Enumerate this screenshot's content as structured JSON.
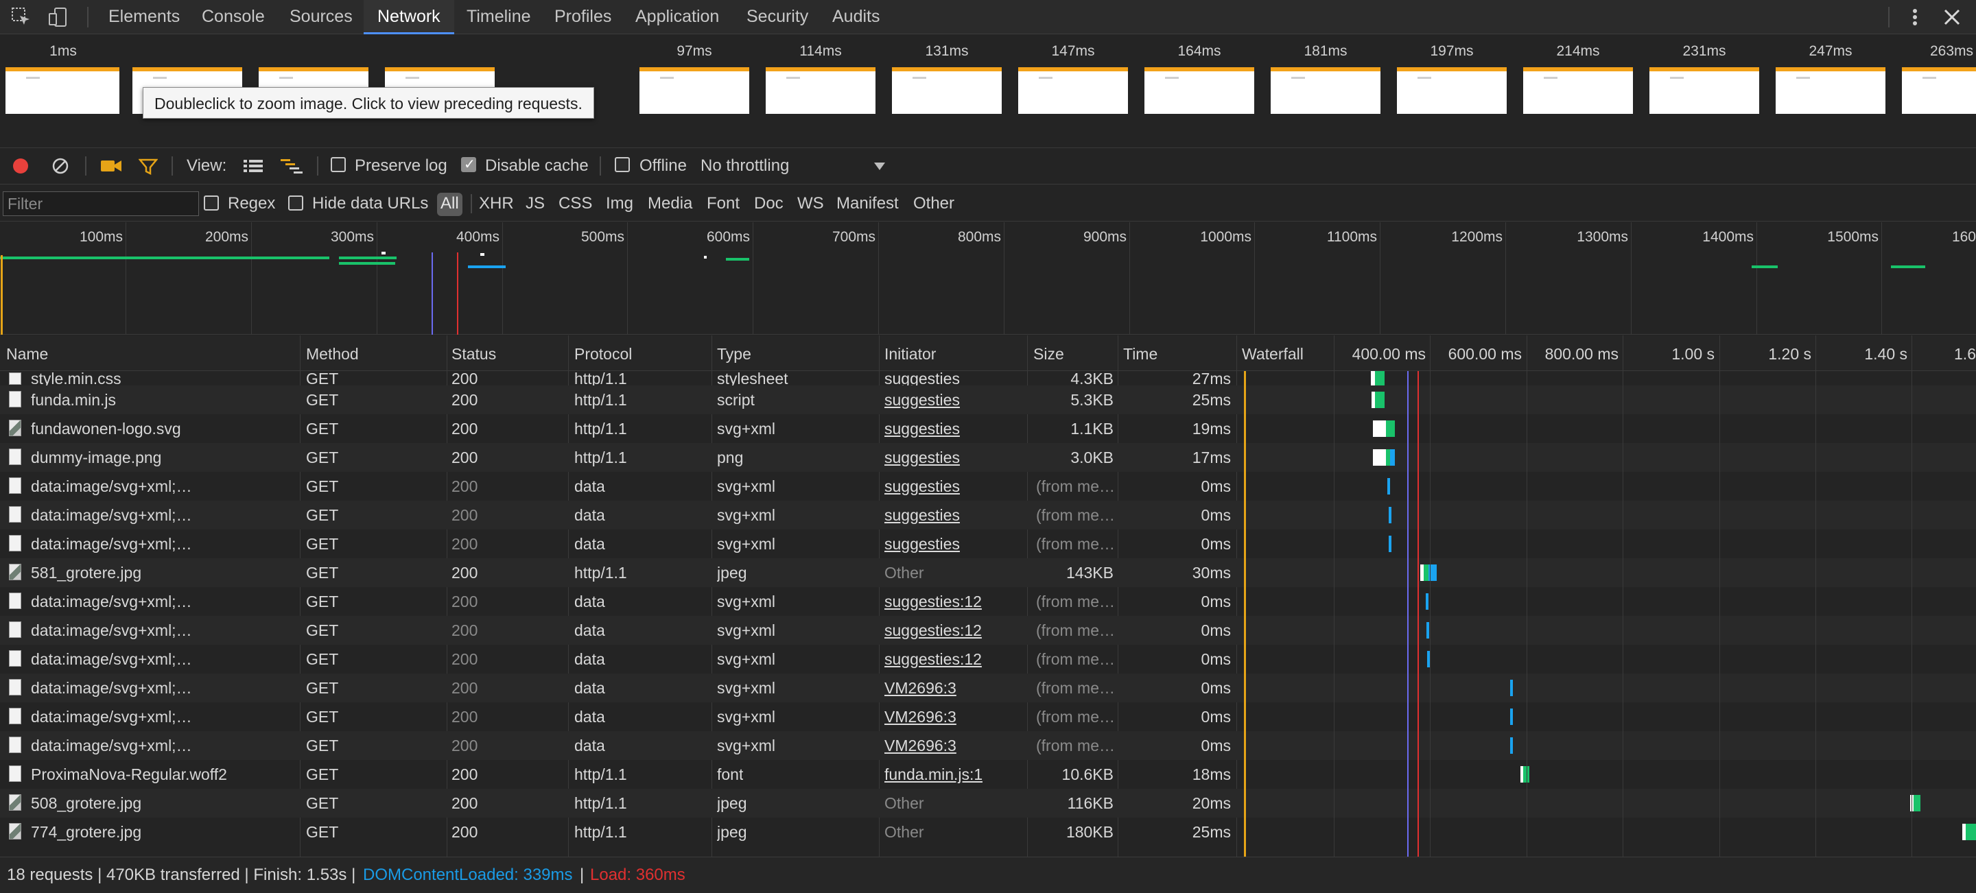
{
  "tabs": [
    "Elements",
    "Console",
    "Sources",
    "Network",
    "Timeline",
    "Profiles",
    "Application",
    "Security",
    "Audits"
  ],
  "active_tab": "Network",
  "filmstrip": {
    "labels": [
      "1ms",
      "",
      "",
      "",
      "97ms",
      "114ms",
      "131ms",
      "147ms",
      "164ms",
      "181ms",
      "197ms",
      "214ms",
      "231ms",
      "247ms",
      "263ms"
    ],
    "tooltip": "Doubleclick to zoom image. Click to view preceding requests."
  },
  "toolbar": {
    "view_label": "View:",
    "preserve_log": "Preserve log",
    "disable_cache": "Disable cache",
    "offline": "Offline",
    "throttling": "No throttling"
  },
  "filter": {
    "placeholder": "Filter",
    "regex": "Regex",
    "hide_data_urls": "Hide data URLs",
    "types": [
      "All",
      "XHR",
      "JS",
      "CSS",
      "Img",
      "Media",
      "Font",
      "Doc",
      "WS",
      "Manifest",
      "Other"
    ]
  },
  "overview_ticks": [
    "100ms",
    "200ms",
    "300ms",
    "400ms",
    "500ms",
    "600ms",
    "700ms",
    "800ms",
    "900ms",
    "1000ms",
    "1100ms",
    "1200ms",
    "1300ms",
    "1400ms",
    "1500ms",
    "160"
  ],
  "columns": {
    "name": "Name",
    "method": "Method",
    "status": "Status",
    "protocol": "Protocol",
    "type": "Type",
    "initiator": "Initiator",
    "size": "Size",
    "time": "Time",
    "waterfall": "Waterfall"
  },
  "waterfall_ticks": [
    "400.00 ms",
    "600.00 ms",
    "800.00 ms",
    "1.00 s",
    "1.20 s",
    "1.40 s",
    "1.6"
  ],
  "requests": [
    {
      "name": "style.min.css",
      "method": "GET",
      "status": "200",
      "protocol": "http/1.1",
      "type": "stylesheet",
      "initiator": "suggesties",
      "size": "4.3KB",
      "time": "27ms",
      "icon": "file"
    },
    {
      "name": "funda.min.js",
      "method": "GET",
      "status": "200",
      "protocol": "http/1.1",
      "type": "script",
      "initiator": "suggesties",
      "size": "5.3KB",
      "time": "25ms",
      "icon": "file"
    },
    {
      "name": "fundawonen-logo.svg",
      "method": "GET",
      "status": "200",
      "protocol": "http/1.1",
      "type": "svg+xml",
      "initiator": "suggesties",
      "size": "1.1KB",
      "time": "19ms",
      "icon": "img"
    },
    {
      "name": "dummy-image.png",
      "method": "GET",
      "status": "200",
      "protocol": "http/1.1",
      "type": "png",
      "initiator": "suggesties",
      "size": "3.0KB",
      "time": "17ms",
      "icon": "file"
    },
    {
      "name": "data:image/svg+xml;…",
      "method": "GET",
      "status": "200",
      "protocol": "data",
      "type": "svg+xml",
      "initiator": "suggesties",
      "size": "(from me…",
      "time": "0ms",
      "icon": "file"
    },
    {
      "name": "data:image/svg+xml;…",
      "method": "GET",
      "status": "200",
      "protocol": "data",
      "type": "svg+xml",
      "initiator": "suggesties",
      "size": "(from me…",
      "time": "0ms",
      "icon": "file"
    },
    {
      "name": "data:image/svg+xml;…",
      "method": "GET",
      "status": "200",
      "protocol": "data",
      "type": "svg+xml",
      "initiator": "suggesties",
      "size": "(from me…",
      "time": "0ms",
      "icon": "file"
    },
    {
      "name": "581_grotere.jpg",
      "method": "GET",
      "status": "200",
      "protocol": "http/1.1",
      "type": "jpeg",
      "initiator": "Other",
      "size": "143KB",
      "time": "30ms",
      "icon": "img"
    },
    {
      "name": "data:image/svg+xml;…",
      "method": "GET",
      "status": "200",
      "protocol": "data",
      "type": "svg+xml",
      "initiator": "suggesties:12",
      "size": "(from me…",
      "time": "0ms",
      "icon": "file"
    },
    {
      "name": "data:image/svg+xml;…",
      "method": "GET",
      "status": "200",
      "protocol": "data",
      "type": "svg+xml",
      "initiator": "suggesties:12",
      "size": "(from me…",
      "time": "0ms",
      "icon": "file"
    },
    {
      "name": "data:image/svg+xml;…",
      "method": "GET",
      "status": "200",
      "protocol": "data",
      "type": "svg+xml",
      "initiator": "suggesties:12",
      "size": "(from me…",
      "time": "0ms",
      "icon": "file"
    },
    {
      "name": "data:image/svg+xml;…",
      "method": "GET",
      "status": "200",
      "protocol": "data",
      "type": "svg+xml",
      "initiator": "VM2696:3",
      "size": "(from me…",
      "time": "0ms",
      "icon": "file"
    },
    {
      "name": "data:image/svg+xml;…",
      "method": "GET",
      "status": "200",
      "protocol": "data",
      "type": "svg+xml",
      "initiator": "VM2696:3",
      "size": "(from me…",
      "time": "0ms",
      "icon": "file"
    },
    {
      "name": "data:image/svg+xml;…",
      "method": "GET",
      "status": "200",
      "protocol": "data",
      "type": "svg+xml",
      "initiator": "VM2696:3",
      "size": "(from me…",
      "time": "0ms",
      "icon": "file"
    },
    {
      "name": "ProximaNova-Regular.woff2",
      "method": "GET",
      "status": "200",
      "protocol": "http/1.1",
      "type": "font",
      "initiator": "funda.min.js:1",
      "size": "10.6KB",
      "time": "18ms",
      "icon": "file"
    },
    {
      "name": "508_grotere.jpg",
      "method": "GET",
      "status": "200",
      "protocol": "http/1.1",
      "type": "jpeg",
      "initiator": "Other",
      "size": "116KB",
      "time": "20ms",
      "icon": "img"
    },
    {
      "name": "774_grotere.jpg",
      "method": "GET",
      "status": "200",
      "protocol": "http/1.1",
      "type": "jpeg",
      "initiator": "Other",
      "size": "180KB",
      "time": "25ms",
      "icon": "img"
    }
  ],
  "status_bar": {
    "summary": "18 requests | 470KB transferred | Finish: 1.53s |",
    "dom_content_loaded": "DOMContentLoaded: 339ms",
    "separator": "|",
    "load": "Load: 360ms"
  },
  "colors": {
    "record": "#e8413c",
    "dom_content_loaded": "#1a9be6",
    "load": "#e03030",
    "waiting": "#19c26a",
    "download": "#1aa3f0",
    "active_tab_underline": "#4d90fe",
    "filter_icon": "#e6a417"
  }
}
